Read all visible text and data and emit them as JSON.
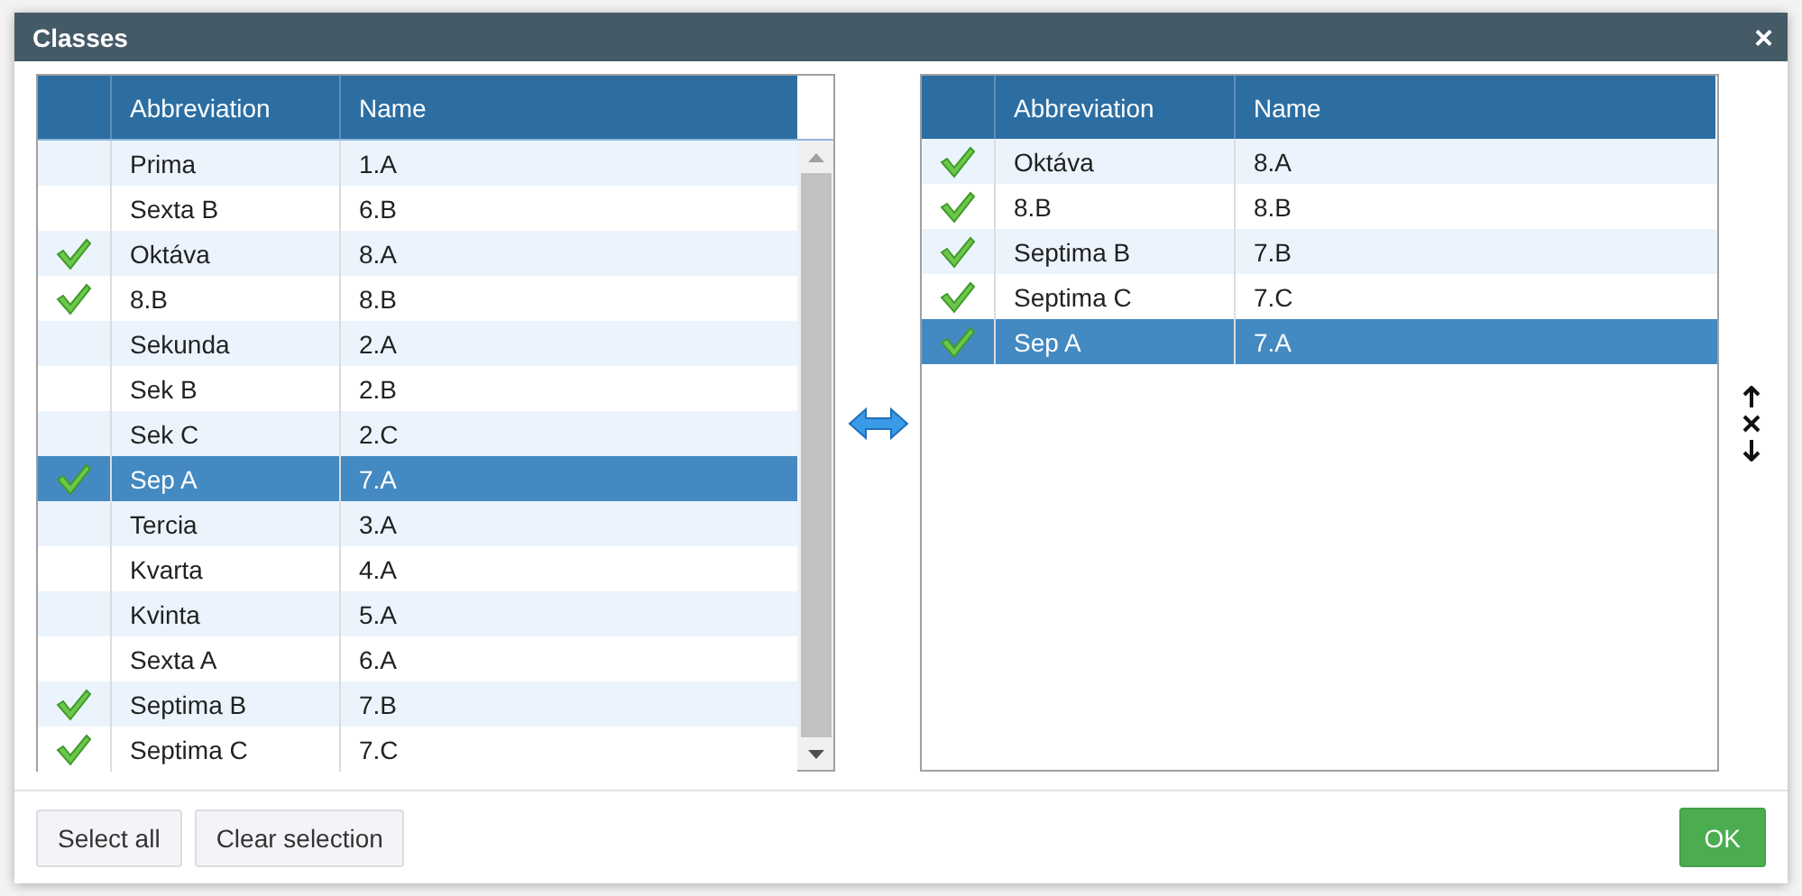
{
  "window": {
    "title": "Classes",
    "close": "×"
  },
  "available": {
    "columns": [
      "Abbreviation",
      "Name"
    ],
    "rows": [
      {
        "abbreviation": "Prima",
        "name": "1.A",
        "checked": false,
        "selected": false
      },
      {
        "abbreviation": "Sexta B",
        "name": "6.B",
        "checked": false,
        "selected": false
      },
      {
        "abbreviation": "Oktáva",
        "name": "8.A",
        "checked": true,
        "selected": false
      },
      {
        "abbreviation": "8.B",
        "name": "8.B",
        "checked": true,
        "selected": false
      },
      {
        "abbreviation": "Sekunda",
        "name": "2.A",
        "checked": false,
        "selected": false
      },
      {
        "abbreviation": "Sek B",
        "name": "2.B",
        "checked": false,
        "selected": false
      },
      {
        "abbreviation": "Sek C",
        "name": "2.C",
        "checked": false,
        "selected": false
      },
      {
        "abbreviation": "Sep A",
        "name": "7.A",
        "checked": true,
        "selected": true
      },
      {
        "abbreviation": "Tercia",
        "name": "3.A",
        "checked": false,
        "selected": false
      },
      {
        "abbreviation": "Kvarta",
        "name": "4.A",
        "checked": false,
        "selected": false
      },
      {
        "abbreviation": "Kvinta",
        "name": "5.A",
        "checked": false,
        "selected": false
      },
      {
        "abbreviation": "Sexta A",
        "name": "6.A",
        "checked": false,
        "selected": false
      },
      {
        "abbreviation": "Septima B",
        "name": "7.B",
        "checked": true,
        "selected": false
      },
      {
        "abbreviation": "Septima C",
        "name": "7.C",
        "checked": true,
        "selected": false
      }
    ]
  },
  "chosen": {
    "columns": [
      "Abbreviation",
      "Name"
    ],
    "rows": [
      {
        "abbreviation": "Oktáva",
        "name": "8.A",
        "checked": true,
        "selected": false
      },
      {
        "abbreviation": "8.B",
        "name": "8.B",
        "checked": true,
        "selected": false
      },
      {
        "abbreviation": "Septima B",
        "name": "7.B",
        "checked": true,
        "selected": false
      },
      {
        "abbreviation": "Septima C",
        "name": "7.C",
        "checked": true,
        "selected": false
      },
      {
        "abbreviation": "Sep A",
        "name": "7.A",
        "checked": true,
        "selected": true
      }
    ]
  },
  "footer": {
    "buttons": [
      "Select all",
      "Clear selection"
    ],
    "ok": "OK"
  }
}
